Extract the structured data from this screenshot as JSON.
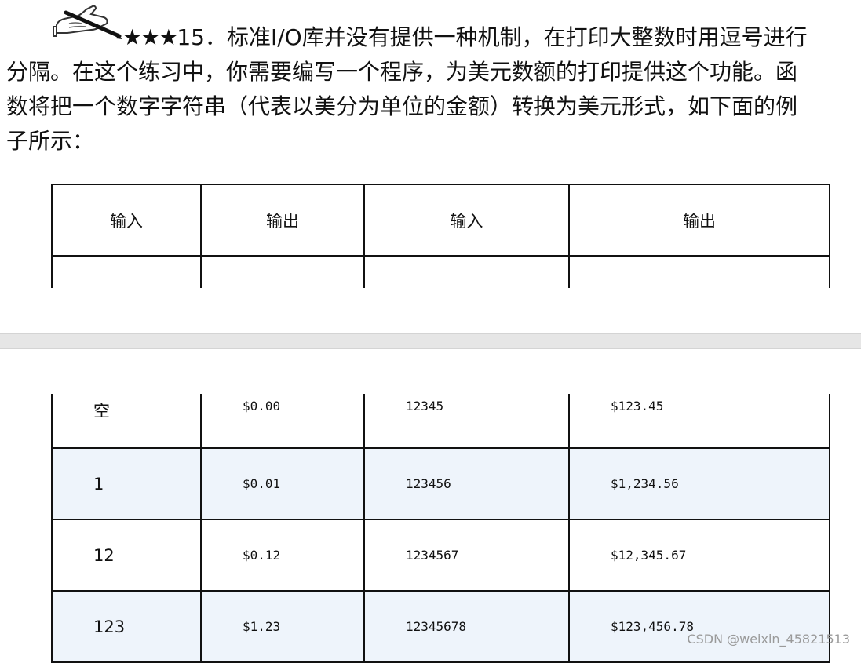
{
  "exercise": {
    "stars": "★★★",
    "number": "15",
    "text_line1": "．标准I/O库并没有提供一种机制，在打印大整数时用逗号进行",
    "text_line2": "分隔。在这个练习中，你需要编写一个程序，为美元数额的打印提供这个功能。函",
    "text_line3": "数将把一个数字字符串（代表以美分为单位的金额）转换为美元形式，如下面的例",
    "text_line4": "子所示："
  },
  "table": {
    "headers": [
      "输入",
      "输出",
      "输入",
      "输出"
    ],
    "rows": [
      [
        "空",
        "$0.00",
        "12345",
        "$123.45"
      ],
      [
        "1",
        "$0.01",
        "123456",
        "$1,234.56"
      ],
      [
        "12",
        "$0.12",
        "1234567",
        "$12,345.67"
      ],
      [
        "123",
        "$1.23",
        "12345678",
        "$123,456.78"
      ]
    ]
  },
  "watermark": "CSDN @weixin_45821513",
  "colors": {
    "shaded_row": "#eef4fb",
    "page_gap": "#e6e6e6",
    "text": "#111111"
  },
  "icons": {
    "exercise_marker": "writing-hand-icon"
  }
}
